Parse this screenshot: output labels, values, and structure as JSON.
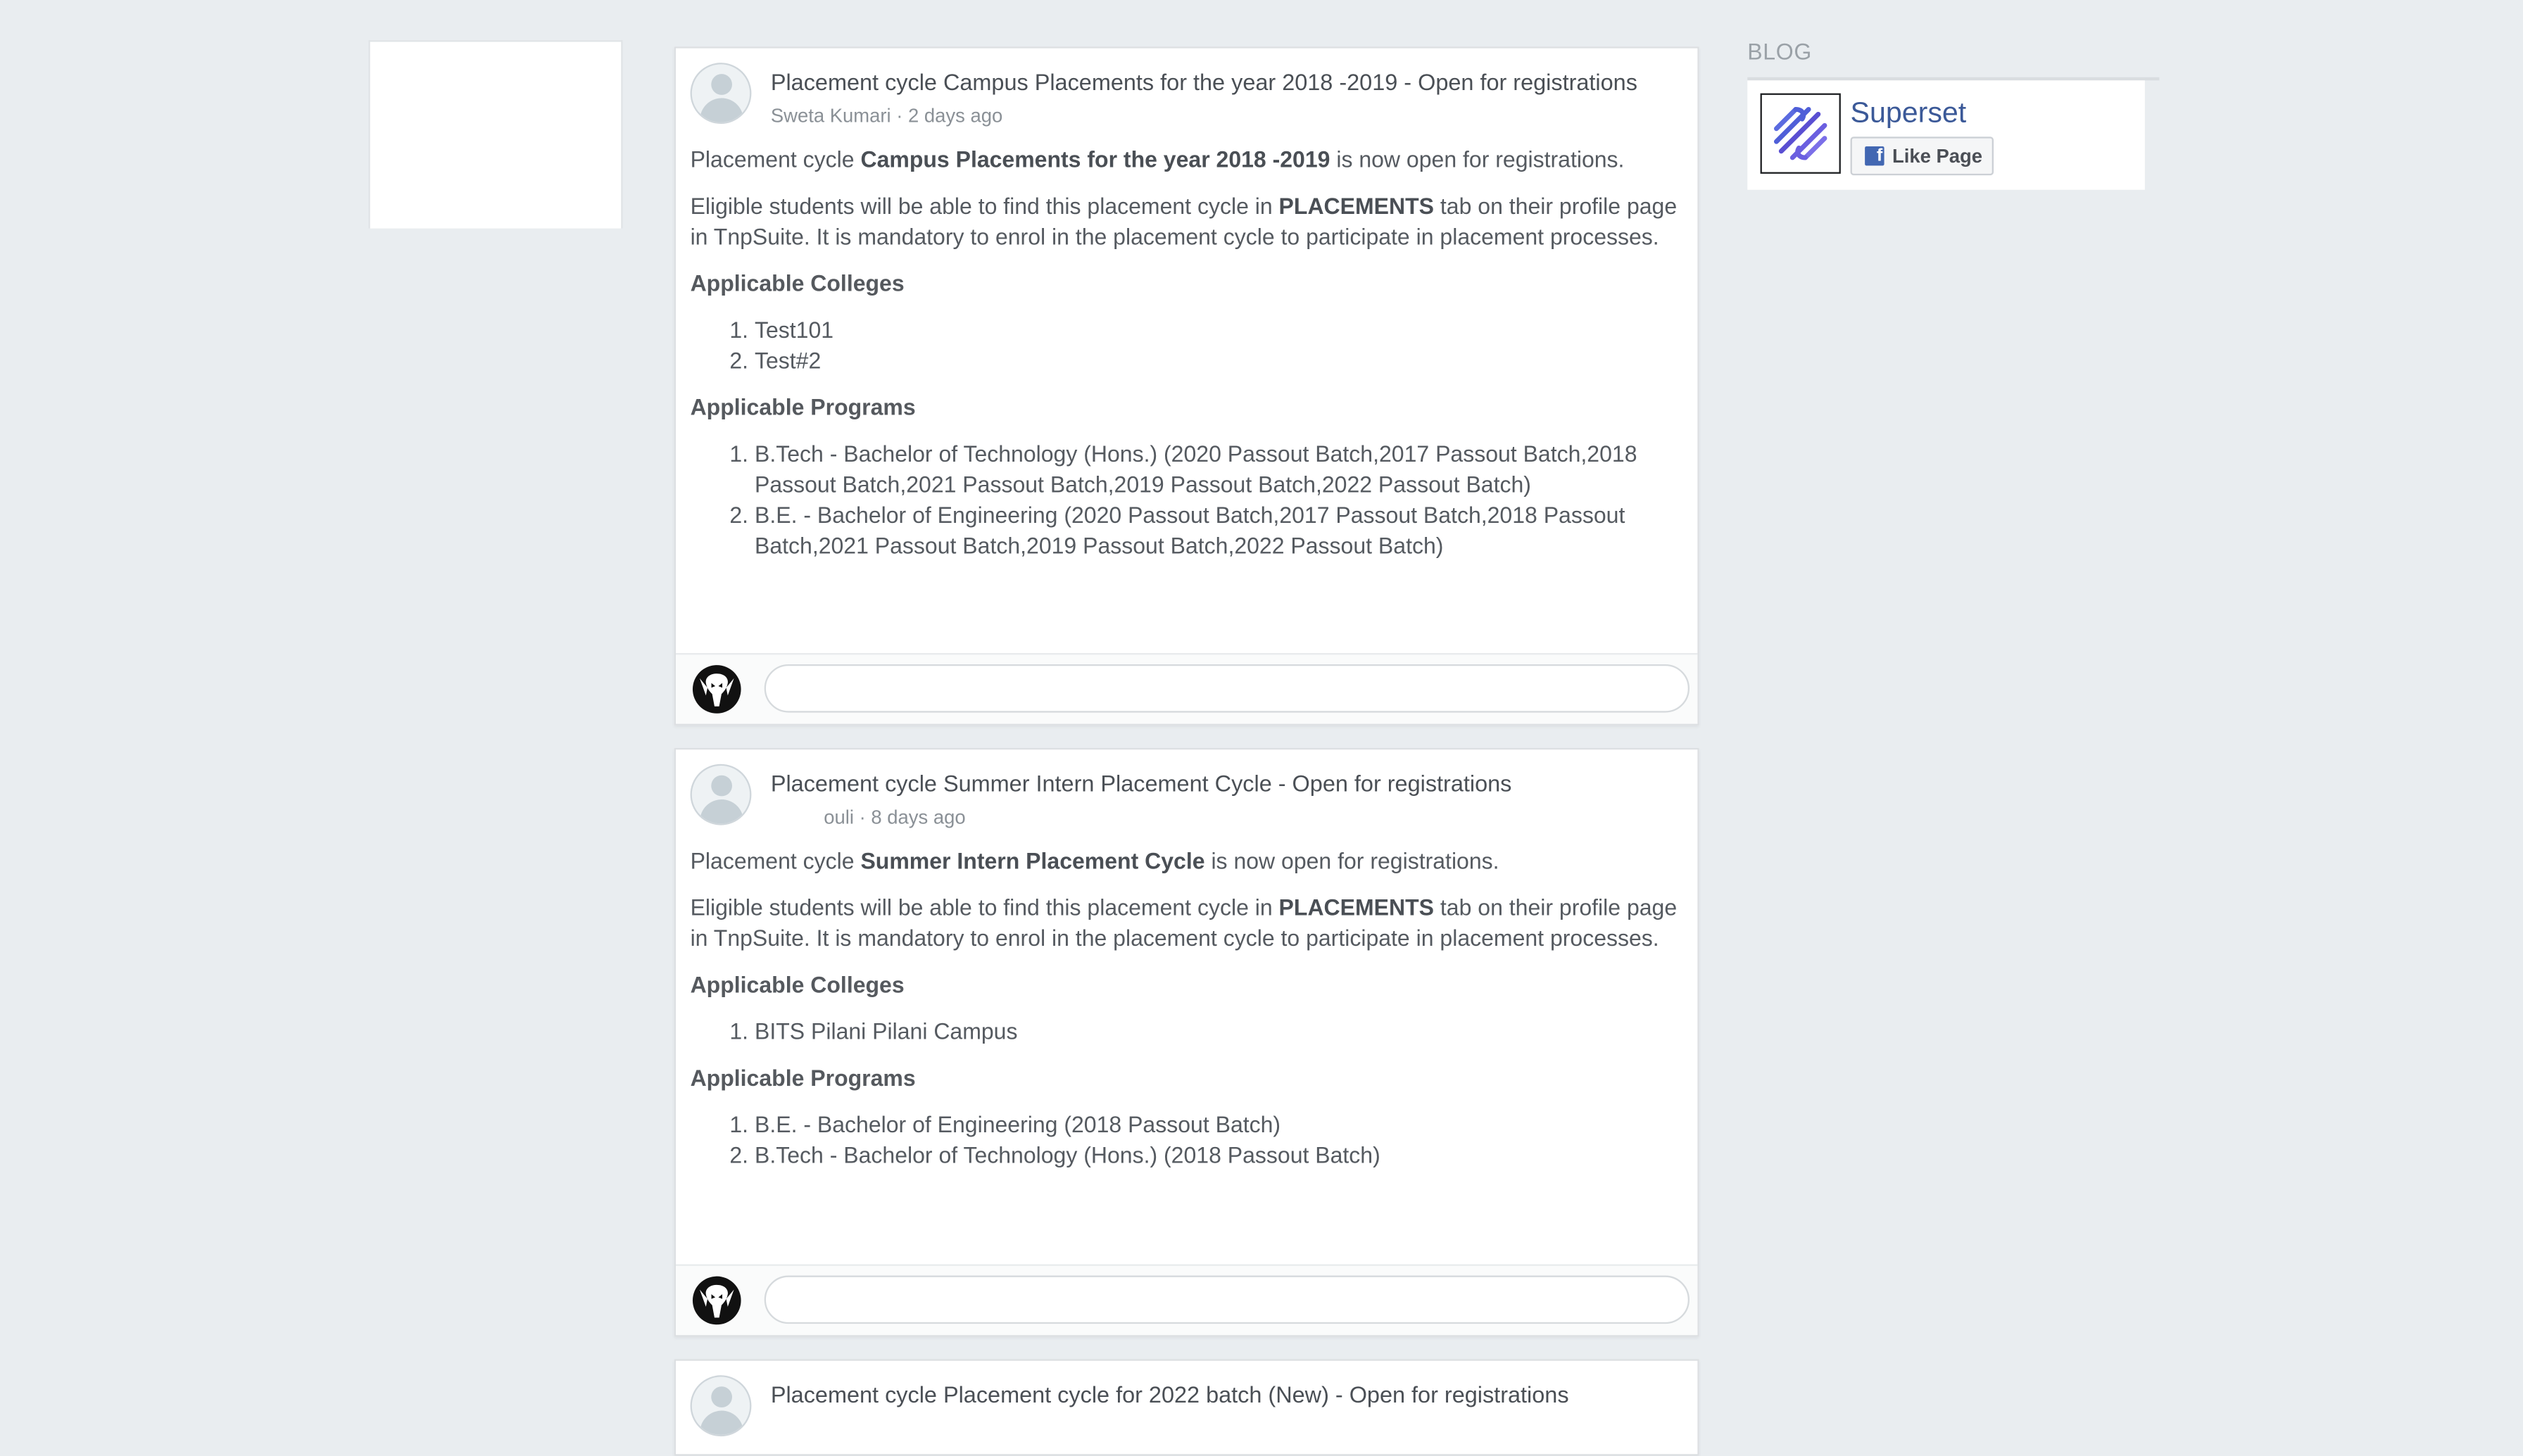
{
  "blog": {
    "label": "BLOG",
    "page_name": "Superset",
    "like_label": "Like Page",
    "facebook_glyph": "f"
  },
  "posts": [
    {
      "title": "Placement cycle Campus Placements for the year 2018 -2019 - Open for registrations",
      "author": "Sweta Kumari",
      "time": "2 days ago",
      "intro_prefix": "Placement cycle ",
      "intro_bold": "Campus Placements for the year 2018 -2019",
      "intro_suffix": " is now open for registrations.",
      "eligible_prefix": "Eligible students will be able to find this placement cycle in ",
      "eligible_bold": "PLACEMENTS",
      "eligible_suffix": " tab on their profile page in TnpSuite. It is mandatory to enrol in the placement cycle to participate in placement processes.",
      "colleges_heading": "Applicable Colleges",
      "colleges": [
        "Test101",
        "Test#2"
      ],
      "programs_heading": "Applicable Programs",
      "programs": [
        "B.Tech - Bachelor of Technology (Hons.) (2020 Passout Batch,2017 Passout Batch,2018 Passout Batch,2021 Passout Batch,2019 Passout Batch,2022 Passout Batch)",
        "B.E. - Bachelor of Engineering (2020 Passout Batch,2017 Passout Batch,2018 Passout Batch,2021 Passout Batch,2019 Passout Batch,2022 Passout Batch)"
      ]
    },
    {
      "title": "Placement cycle Summer Intern Placement Cycle - Open for registrations",
      "author": "ouli",
      "time": "8 days ago",
      "intro_prefix": "Placement cycle ",
      "intro_bold": "Summer Intern Placement Cycle",
      "intro_suffix": " is now open for registrations.",
      "eligible_prefix": "Eligible students will be able to find this placement cycle in ",
      "eligible_bold": "PLACEMENTS",
      "eligible_suffix": " tab on their profile page in TnpSuite. It is mandatory to enrol in the placement cycle to participate in placement processes.",
      "colleges_heading": "Applicable Colleges",
      "colleges": [
        "BITS Pilani Pilani Campus"
      ],
      "programs_heading": "Applicable Programs",
      "programs": [
        "B.E. - Bachelor of Engineering (2018 Passout Batch)",
        "B.Tech - Bachelor of Technology (Hons.) (2018 Passout Batch)"
      ]
    },
    {
      "title": "Placement cycle Placement cycle for 2022 batch (New) - Open for registrations"
    }
  ],
  "comment": {
    "input_value": "",
    "placeholder": ""
  },
  "colors": {
    "page_bg": "#e9edf0",
    "card_bg": "#ffffff",
    "facebook_blue": "#4267b2",
    "brand_link": "#3b5998"
  }
}
